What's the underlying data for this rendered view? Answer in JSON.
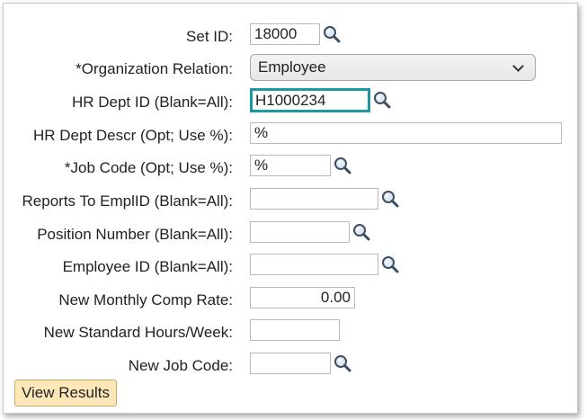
{
  "form": {
    "set_id": {
      "label": "Set ID:",
      "value": "18000",
      "icon": "magnifier-icon"
    },
    "org_relation": {
      "label": "*Organization Relation:",
      "value": "Employee"
    },
    "hr_dept_id": {
      "label": "HR Dept ID (Blank=All):",
      "value": "H1000234",
      "icon": "magnifier-icon"
    },
    "hr_dept_descr": {
      "label": "HR Dept Descr (Opt; Use %):",
      "value": "%"
    },
    "job_code": {
      "label": "*Job Code (Opt; Use %):",
      "value": "%",
      "icon": "magnifier-icon"
    },
    "reports_to": {
      "label": "Reports To EmplID (Blank=All):",
      "value": "",
      "icon": "magnifier-icon"
    },
    "position_number": {
      "label": "Position Number (Blank=All):",
      "value": "",
      "icon": "magnifier-icon"
    },
    "employee_id": {
      "label": "Employee ID (Blank=All):",
      "value": "",
      "icon": "magnifier-icon"
    },
    "monthly_comp": {
      "label": "New Monthly Comp Rate:",
      "value": "0.00"
    },
    "std_hours": {
      "label": "New Standard Hours/Week:",
      "value": ""
    },
    "new_job_code": {
      "label": "New Job Code:",
      "value": "",
      "icon": "magnifier-icon"
    }
  },
  "actions": {
    "view_results_label": "View Results"
  },
  "colors": {
    "focus_border": "#1a9aa0",
    "button_bg": "#fde7b9"
  }
}
